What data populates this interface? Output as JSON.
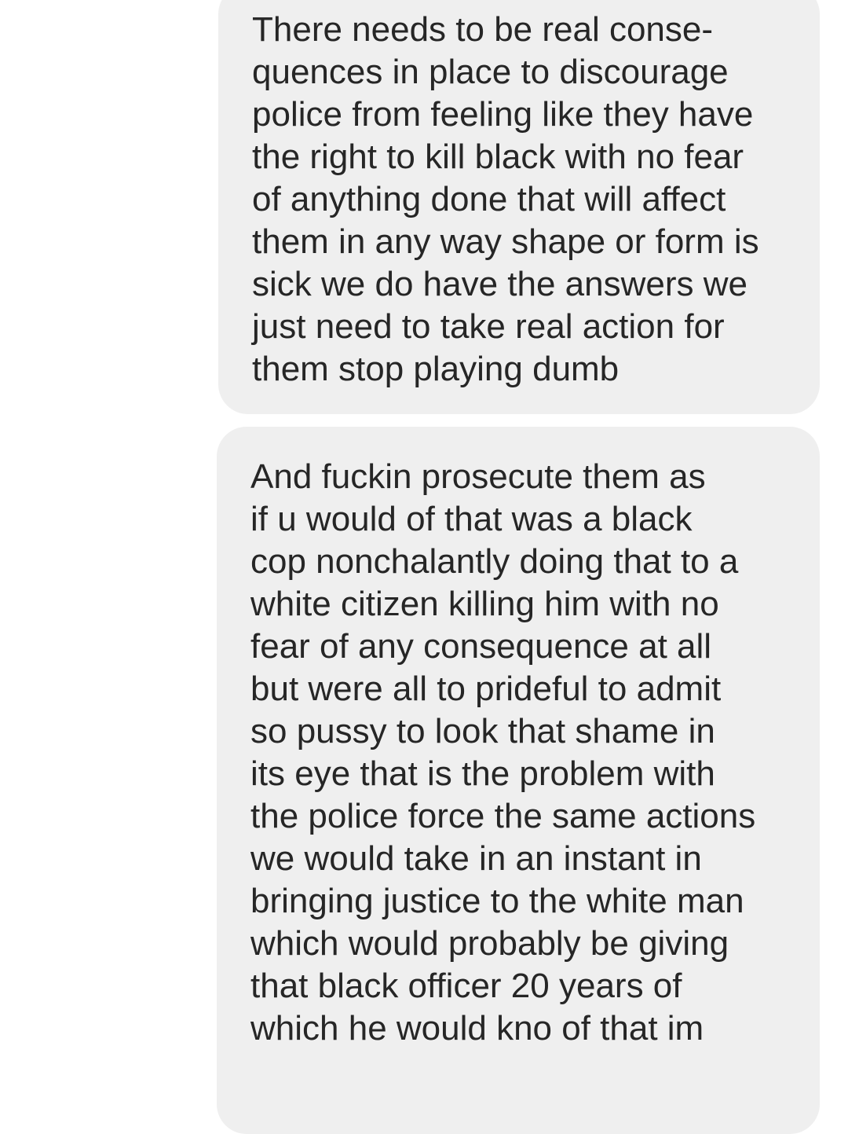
{
  "messages": [
    {
      "lines": [
        "There needs to be real conse-",
        "quences in place to discourage",
        "police from feeling like they have",
        "the right to kill black with no fear",
        "of anything done that will affect",
        "them in any way shape or form is",
        "sick we do have the answers we",
        "just need to take real action for",
        "them stop playing dumb"
      ]
    },
    {
      "lines": [
        "And fuckin prosecute them as",
        "if u would of that was a black",
        "cop nonchalantly doing that to a",
        "white citizen killing him with no",
        "fear of any consequence at all",
        "but were all to prideful to admit",
        "so pussy to look that shame in",
        "its eye that is the problem with",
        "the police force the same actions",
        "we would take in an instant in",
        "bringing justice to the white man",
        "which would probably be giving",
        "that black officer 20 years of",
        "which he would kno of that im"
      ]
    }
  ]
}
